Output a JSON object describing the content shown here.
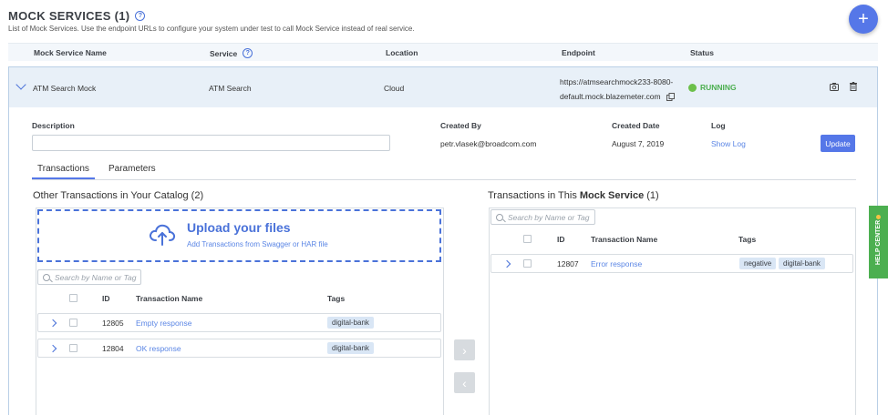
{
  "header": {
    "title": "MOCK SERVICES (1)",
    "subtitle": "List of Mock Services. Use the endpoint URLs to configure your system under test to call Mock Service instead of real service.",
    "add_button": "+"
  },
  "columns": [
    "Mock Service Name",
    "Service",
    "Location",
    "Endpoint",
    "Status"
  ],
  "service": {
    "name": "ATM Search Mock",
    "service": "ATM Search",
    "location": "Cloud",
    "endpoint_line1": "https://atmsearchmock233-8080-",
    "endpoint_line2": "default.mock.blazemeter.com",
    "status": "RUNNING"
  },
  "details": {
    "description_label": "Description",
    "description_value": "",
    "created_by_label": "Created By",
    "created_by": "petr.vlasek@broadcom.com",
    "created_date_label": "Created Date",
    "created_date": "August 7, 2019",
    "log_label": "Log",
    "log_link": "Show Log",
    "update_button": "Update"
  },
  "tabs": [
    "Transactions",
    "Parameters"
  ],
  "catalog": {
    "title": "Other Transactions in Your Catalog (2)",
    "upload_title": "Upload your files",
    "upload_sub": "Add Transactions from Swagger or HAR file",
    "search_placeholder": "Search by Name or Tag",
    "headers": [
      "ID",
      "Transaction Name",
      "Tags"
    ],
    "rows": [
      {
        "id": "12805",
        "name": "Empty response",
        "tags": [
          "digital-bank"
        ]
      },
      {
        "id": "12804",
        "name": "OK response",
        "tags": [
          "digital-bank"
        ]
      }
    ]
  },
  "mock_transactions": {
    "title_prefix": "Transactions in This ",
    "title_bold": "Mock Service",
    "title_suffix": " (1)",
    "search_placeholder": "Search by Name or Tag",
    "headers": [
      "ID",
      "Transaction Name",
      "Tags"
    ],
    "rows": [
      {
        "id": "12807",
        "name": "Error response",
        "tags": [
          "negative",
          "digital-bank"
        ]
      }
    ]
  },
  "move_buttons": {
    "right": "›",
    "left": "‹"
  },
  "help_center": "HELP CENTER",
  "colors": {
    "accent": "#5577e8",
    "running": "#6cc04a",
    "help": "#4caf50"
  }
}
